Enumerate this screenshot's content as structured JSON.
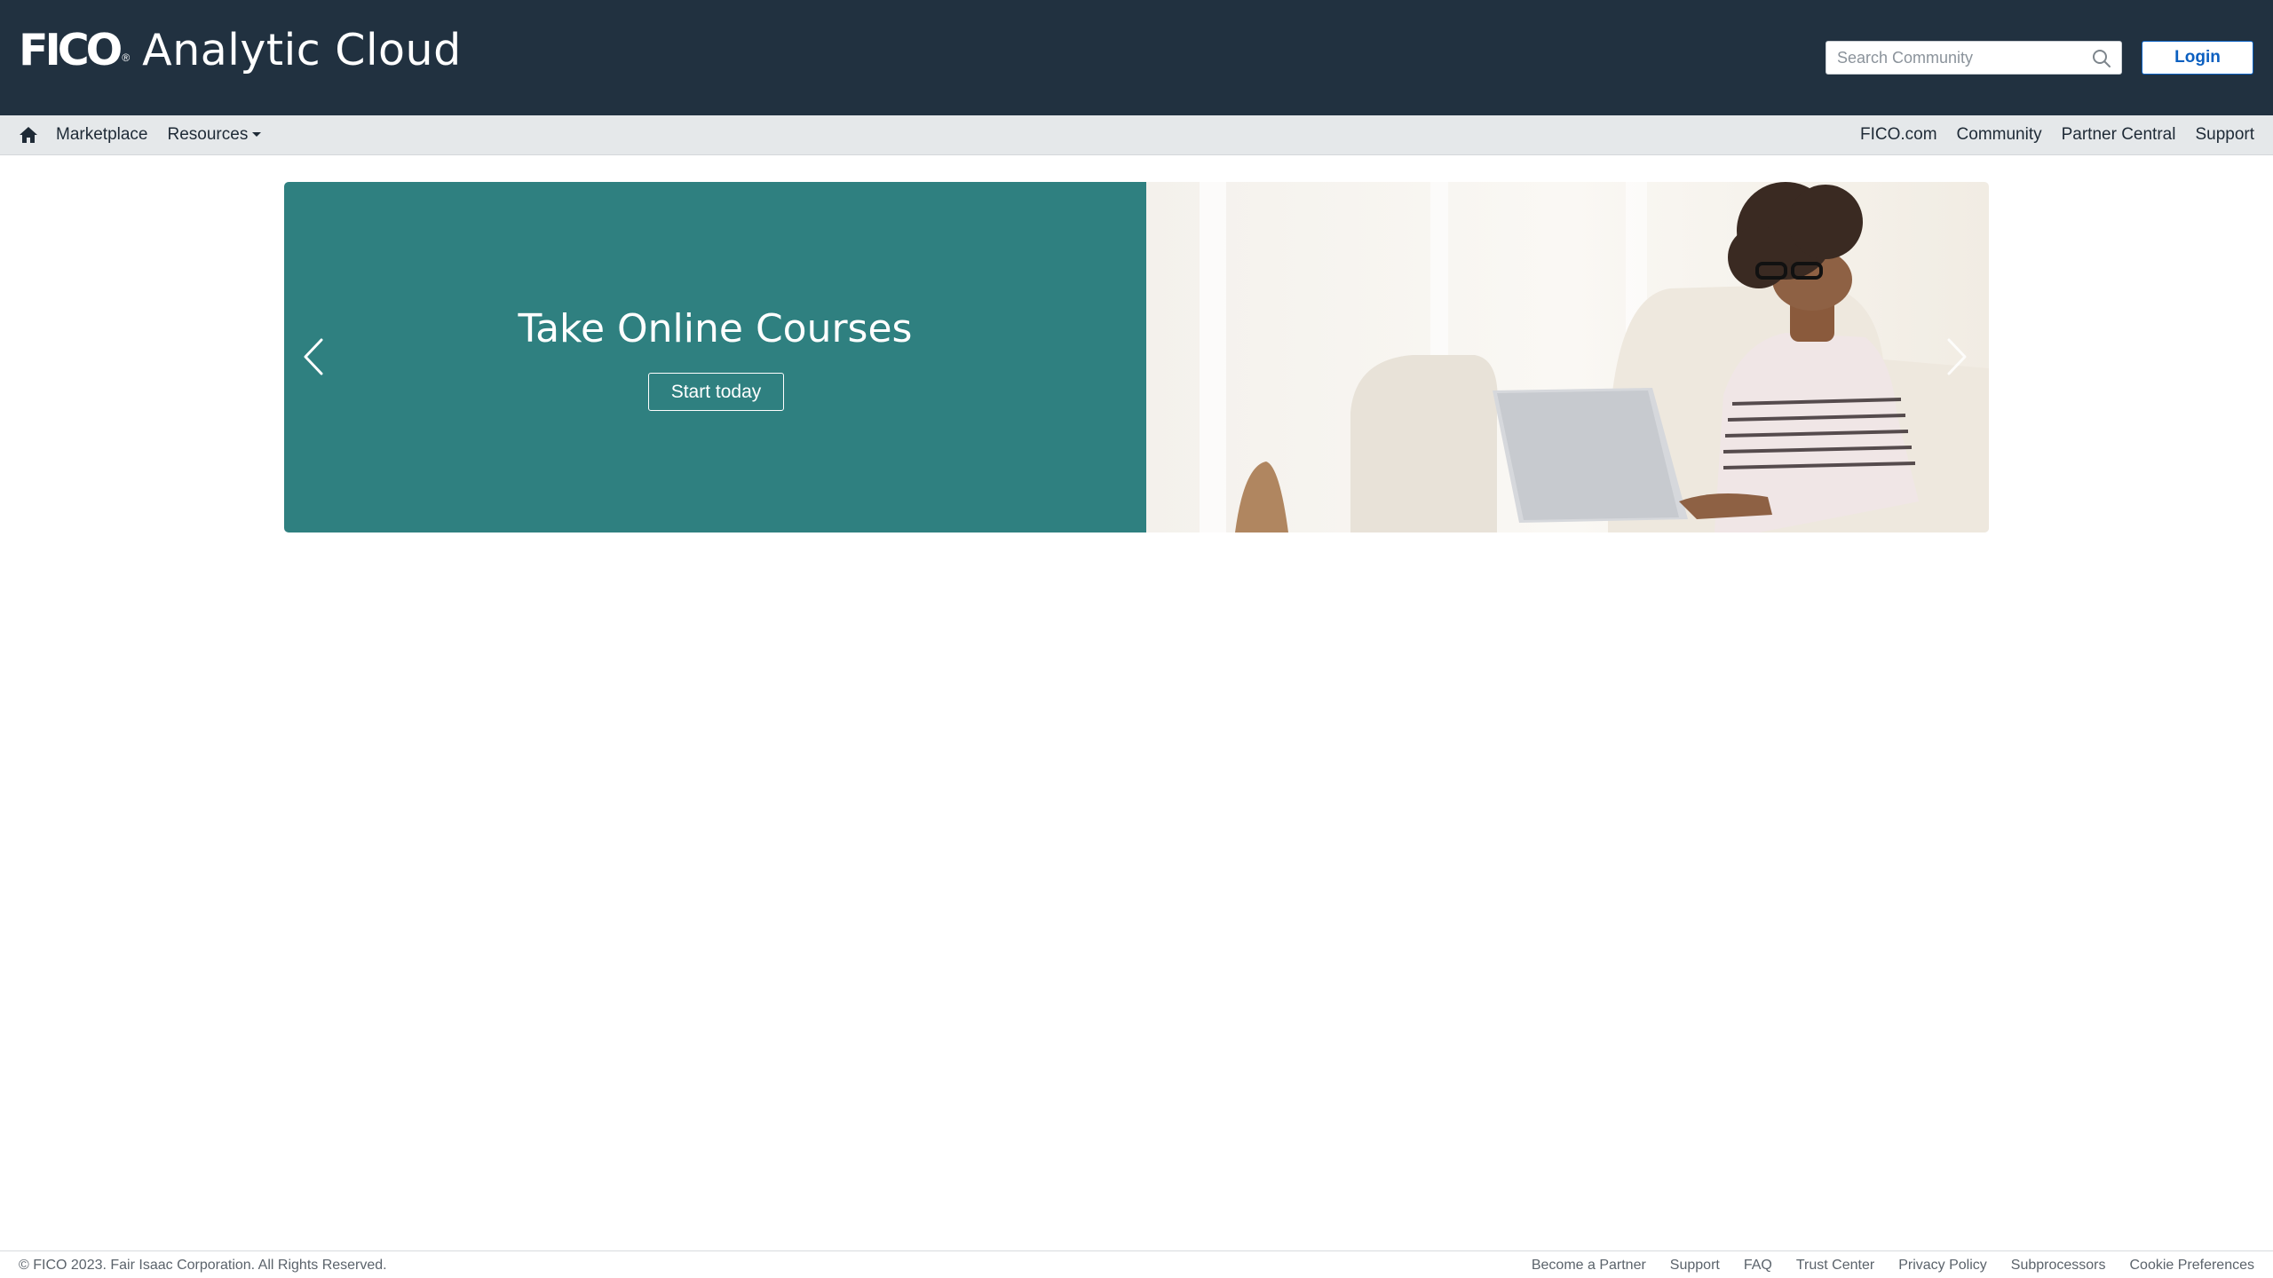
{
  "header": {
    "brand": "FICO",
    "brand_mark": "®",
    "product": "Analytic Cloud",
    "search_placeholder": "Search Community",
    "login_label": "Login"
  },
  "nav": {
    "home_icon": "home-icon",
    "left_items": [
      {
        "label": "Marketplace"
      },
      {
        "label": "Resources",
        "has_dropdown": true
      }
    ],
    "right_items": [
      {
        "label": "FICO.com"
      },
      {
        "label": "Community"
      },
      {
        "label": "Partner Central"
      },
      {
        "label": "Support"
      }
    ]
  },
  "carousel": {
    "title": "Take Online Courses",
    "cta_label": "Start today",
    "panel_color": "#2f8080",
    "prev_icon": "chevron-left-icon",
    "next_icon": "chevron-right-icon"
  },
  "footer": {
    "copyright": "© FICO 2023. Fair Isaac Corporation. All Rights Reserved.",
    "links": [
      "Become a Partner",
      "Support",
      "FAQ",
      "Trust Center",
      "Privacy Policy",
      "Subprocessors",
      "Cookie Preferences"
    ]
  },
  "colors": {
    "header_bg": "#213140",
    "nav_bg": "#e5e8ea",
    "login_accent": "#0b5fc0"
  }
}
